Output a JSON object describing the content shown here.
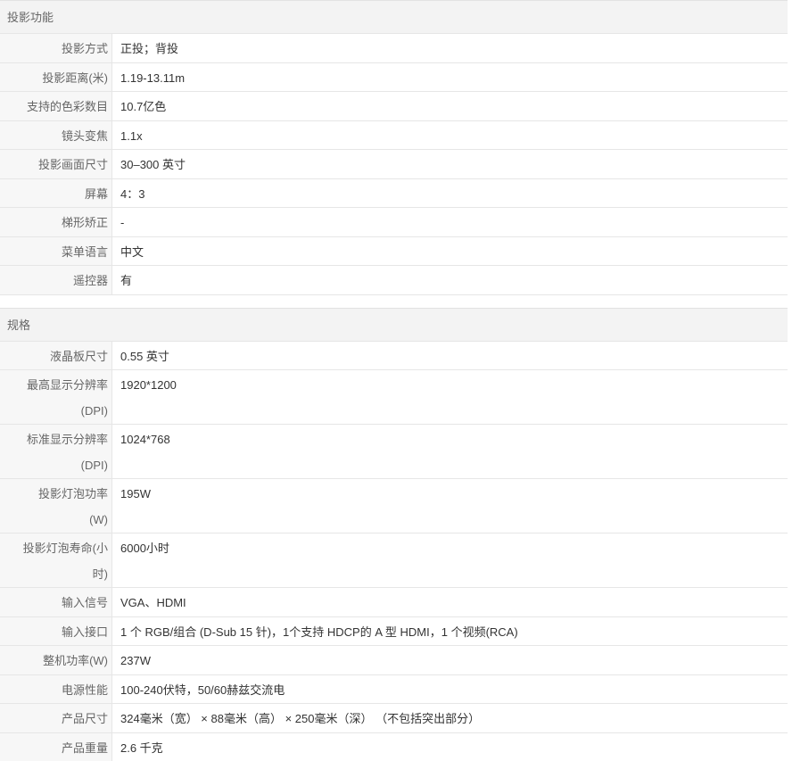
{
  "sections": [
    {
      "title": "投影功能",
      "rows": [
        {
          "label": "投影方式",
          "value": "正投；背投"
        },
        {
          "label": "投影距离(米)",
          "value": "1.19-13.11m"
        },
        {
          "label": "支持的色彩数目",
          "value": "10.7亿色"
        },
        {
          "label": "镜头变焦",
          "value": "1.1x"
        },
        {
          "label": "投影画面尺寸",
          "value": "30–300 英寸"
        },
        {
          "label": "屏幕",
          "value": "4：3"
        },
        {
          "label": "梯形矫正",
          "value": "-"
        },
        {
          "label": "菜单语言",
          "value": "中文"
        },
        {
          "label": "遥控器",
          "value": "有"
        }
      ]
    },
    {
      "title": "规格",
      "rows": [
        {
          "label": "液晶板尺寸",
          "value": "0.55 英寸"
        },
        {
          "label": "最高显示分辨率\n(DPI)",
          "value": "1920*1200"
        },
        {
          "label": "标准显示分辨率\n(DPI)",
          "value": "1024*768"
        },
        {
          "label": "投影灯泡功率\n(W)",
          "value": "195W"
        },
        {
          "label": "投影灯泡寿命(小\n时)",
          "value": "6000小时"
        },
        {
          "label": "输入信号",
          "value": "VGA、HDMI"
        },
        {
          "label": "输入接口",
          "value": "1 个 RGB/组合 (D-Sub 15 针)，1个支持 HDCP的 A 型 HDMI，1 个视频(RCA)"
        },
        {
          "label": "整机功率(W)",
          "value": "237W"
        },
        {
          "label": "电源性能",
          "value": "100-240伏特，50/60赫兹交流电"
        },
        {
          "label": "产品尺寸",
          "value": "324毫米（宽） × 88毫米（高） × 250毫米（深） （不包括突出部分）"
        },
        {
          "label": "产品重量",
          "value": "2.6 千克"
        }
      ]
    }
  ]
}
